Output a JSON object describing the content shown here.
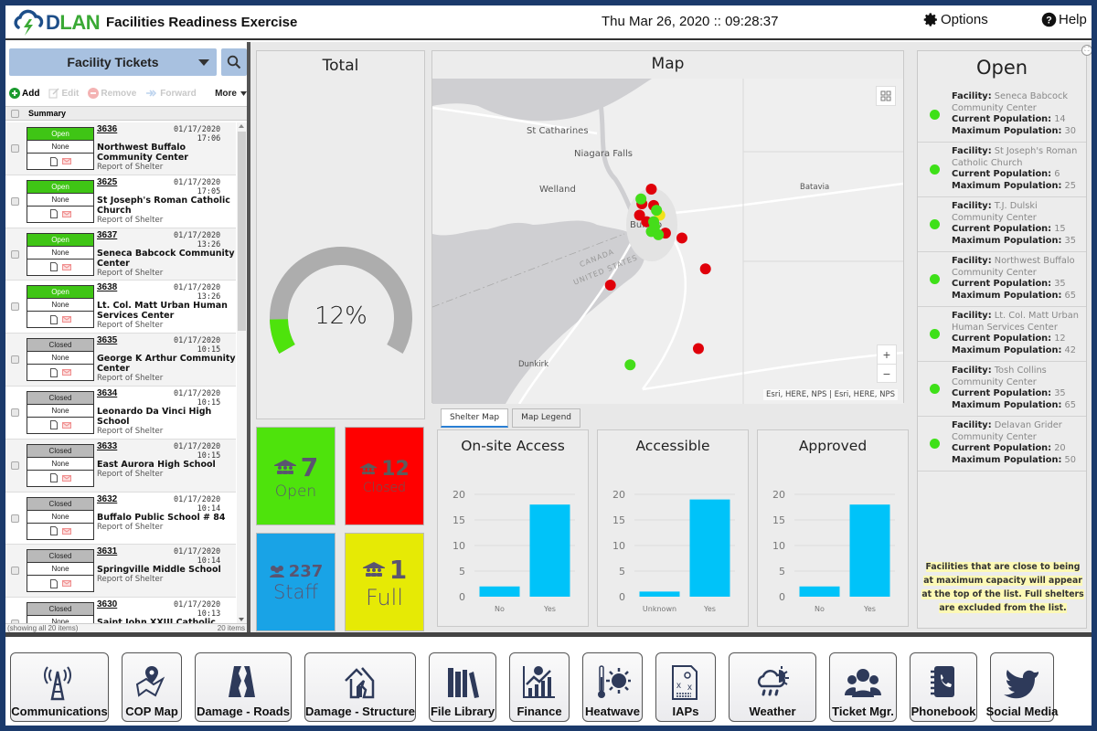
{
  "header": {
    "logo_text_d": "D",
    "logo_text_lan": "LAN",
    "title": "Facilities Readiness Exercise",
    "datetime": "Thu Mar 26, 2020 :: 09:28:37",
    "options_label": "Options",
    "help_label": "Help"
  },
  "tickets": {
    "selector_label": "Facility Tickets",
    "toolbar": {
      "add": "Add",
      "edit": "Edit",
      "remove": "Remove",
      "forward": "Forward",
      "more": "More"
    },
    "column_header": "Summary",
    "items": [
      {
        "id": "3636",
        "date": "01/17/2020",
        "time": "17:06",
        "status": "Open",
        "priority": "None",
        "name": "Northwest Buffalo Community Center",
        "type": "Report of Shelter"
      },
      {
        "id": "3625",
        "date": "01/17/2020",
        "time": "17:05",
        "status": "Open",
        "priority": "None",
        "name": "St Joseph's Roman Catholic Church",
        "type": "Report of Shelter"
      },
      {
        "id": "3637",
        "date": "01/17/2020",
        "time": "13:26",
        "status": "Open",
        "priority": "None",
        "name": "Seneca Babcock Community Center",
        "type": "Report of Shelter"
      },
      {
        "id": "3638",
        "date": "01/17/2020",
        "time": "13:26",
        "status": "Open",
        "priority": "None",
        "name": "Lt. Col. Matt Urban Human Services Center",
        "type": "Report of Shelter"
      },
      {
        "id": "3635",
        "date": "01/17/2020",
        "time": "10:15",
        "status": "Closed",
        "priority": "None",
        "name": "George K Arthur Community Center",
        "type": "Report of Shelter"
      },
      {
        "id": "3634",
        "date": "01/17/2020",
        "time": "10:15",
        "status": "Closed",
        "priority": "None",
        "name": "Leonardo Da Vinci High School",
        "type": "Report of Shelter"
      },
      {
        "id": "3633",
        "date": "01/17/2020",
        "time": "10:15",
        "status": "Closed",
        "priority": "None",
        "name": "East Aurora High School",
        "type": "Report of Shelter"
      },
      {
        "id": "3632",
        "date": "01/17/2020",
        "time": "10:14",
        "status": "Closed",
        "priority": "None",
        "name": "Buffalo Public School # 84",
        "type": "Report of Shelter"
      },
      {
        "id": "3631",
        "date": "01/17/2020",
        "time": "10:14",
        "status": "Closed",
        "priority": "None",
        "name": "Springville Middle School",
        "type": "Report of Shelter"
      },
      {
        "id": "3630",
        "date": "01/17/2020",
        "time": "10:13",
        "status": "Closed",
        "priority": "None",
        "name": "Saint John XXIII Catholic",
        "type": ""
      }
    ],
    "footer_left": "(showing all 20 items)",
    "footer_right": "20 items"
  },
  "total": {
    "title": "Total",
    "percent": 12,
    "percent_label": "12%",
    "fill_color": "#4ee30c",
    "track_color": "#adadad"
  },
  "map": {
    "title": "Map",
    "labels": [
      "St Catharines",
      "Niagara Falls",
      "Welland",
      "Batavia",
      "Buffalo",
      "Dunkirk",
      "CANADA",
      "UNITED STATES"
    ],
    "attribution": "Esri, HERE, NPS | Esri, HERE, NPS",
    "zoom_in": "+",
    "zoom_out": "−",
    "tabs": [
      "Shelter Map",
      "Map Legend"
    ],
    "active_tab": "Shelter Map",
    "legend": {
      "open": "#45dd1a",
      "closed": "#e0000a",
      "full": "#f2e21a"
    }
  },
  "kpis": {
    "open": {
      "value": "7",
      "label": "Open"
    },
    "closed": {
      "value": "12",
      "label": "Closed"
    },
    "staff": {
      "value": "237",
      "label": "Staff"
    },
    "full": {
      "value": "1",
      "label": "Full"
    }
  },
  "chart_data": [
    {
      "type": "bar",
      "title": "On-site Access",
      "categories": [
        "No",
        "Yes"
      ],
      "values": [
        2,
        18
      ],
      "ylim": [
        0,
        20
      ],
      "yticks": [
        0,
        5,
        10,
        15,
        20
      ],
      "color": "#00c3f9",
      "grid": true
    },
    {
      "type": "bar",
      "title": "Accessible",
      "categories": [
        "Unknown",
        "Yes"
      ],
      "values": [
        1,
        19
      ],
      "ylim": [
        0,
        20
      ],
      "yticks": [
        0,
        5,
        10,
        15,
        20
      ],
      "color": "#00c3f9",
      "grid": true
    },
    {
      "type": "bar",
      "title": "Approved",
      "categories": [
        "No",
        "Yes"
      ],
      "values": [
        2,
        18
      ],
      "ylim": [
        0,
        20
      ],
      "yticks": [
        0,
        5,
        10,
        15,
        20
      ],
      "color": "#00c3f9",
      "grid": true
    }
  ],
  "open_list": {
    "title": "Open",
    "facility_label": "Facility",
    "current_label": "Current Population:",
    "max_label": "Maximum Population:",
    "items": [
      {
        "facility": "Seneca Babcock Community Center",
        "current": "14",
        "max": "30"
      },
      {
        "facility": "St Joseph's Roman Catholic Church",
        "current": "6",
        "max": "25"
      },
      {
        "facility": "T.J. Dulski Community Center",
        "current": "15",
        "max": "35"
      },
      {
        "facility": "Northwest Buffalo Community Center",
        "current": "35",
        "max": "65"
      },
      {
        "facility": "Lt. Col. Matt Urban Human Services Center",
        "current": "12",
        "max": "42"
      },
      {
        "facility": "Tosh Collins Community Center",
        "current": "35",
        "max": "65"
      },
      {
        "facility": "Delavan Grider Community Center",
        "current": "20",
        "max": "50"
      }
    ],
    "note_part1": "Facilities",
    "note_part2": " that are close to being at maximum capacity will appear at the top of the list. Full shelters are excluded from the list."
  },
  "apps": [
    {
      "label": "Communications",
      "icon": "radio-tower-icon"
    },
    {
      "label": "COP Map",
      "icon": "map-pin-icon"
    },
    {
      "label": "Damage - Roads",
      "icon": "damaged-road-icon"
    },
    {
      "label": "Damage - Structure",
      "icon": "damaged-house-icon"
    },
    {
      "label": "File Library",
      "icon": "books-icon"
    },
    {
      "label": "Finance",
      "icon": "finance-chart-icon"
    },
    {
      "label": "Heatwave",
      "icon": "thermometer-sun-icon"
    },
    {
      "label": "IAPs",
      "icon": "plan-document-icon"
    },
    {
      "label": "Weather",
      "icon": "cloud-rain-sun-icon"
    },
    {
      "label": "Ticket Mgr.",
      "icon": "support-team-icon"
    },
    {
      "label": "Phonebook",
      "icon": "phonebook-icon"
    },
    {
      "label": "Social Media",
      "icon": "bird-icon"
    }
  ]
}
